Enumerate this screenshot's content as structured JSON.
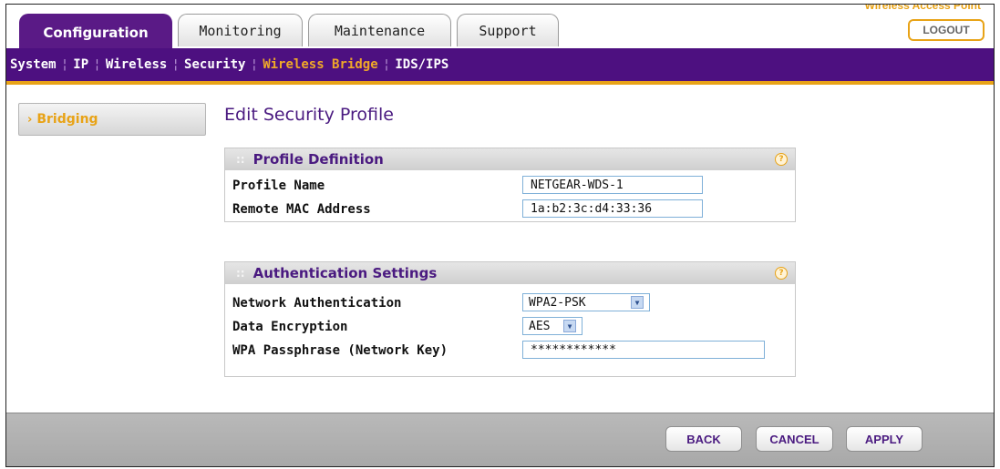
{
  "header": {
    "tabs": [
      {
        "label": "Configuration",
        "active": true
      },
      {
        "label": "Monitoring",
        "active": false
      },
      {
        "label": "Maintenance",
        "active": false
      },
      {
        "label": "Support",
        "active": false
      }
    ],
    "top_link": "Wireless Access Point",
    "logout_label": "LOGOUT"
  },
  "subnav": {
    "items": [
      "System",
      "IP",
      "Wireless",
      "Security",
      "Wireless Bridge",
      "IDS/IPS"
    ],
    "active": "Wireless Bridge"
  },
  "sidebar": {
    "items": [
      {
        "label": "Bridging",
        "active": true
      }
    ]
  },
  "page": {
    "title": "Edit Security Profile"
  },
  "profile_definition": {
    "title": "Profile Definition",
    "fields": [
      {
        "label": "Profile Name",
        "value": "NETGEAR-WDS-1"
      },
      {
        "label": "Remote MAC Address",
        "value": "1a:b2:3c:d4:33:36"
      }
    ]
  },
  "authentication": {
    "title": "Authentication Settings",
    "network_auth": {
      "label": "Network Authentication",
      "value": "WPA2-PSK"
    },
    "encryption": {
      "label": "Data Encryption",
      "value": "AES"
    },
    "passphrase": {
      "label": "WPA Passphrase (Network Key)",
      "value": "************"
    }
  },
  "footer": {
    "back_label": "BACK",
    "cancel_label": "CANCEL",
    "apply_label": "APPLY"
  },
  "colors": {
    "brand_purple": "#4d1080",
    "accent_orange": "#e8a317",
    "field_border": "#7fb0d8"
  },
  "icons": {
    "help": "help-icon",
    "bullet": "chevron-right-icon",
    "dropdown": "chevron-down-icon"
  }
}
